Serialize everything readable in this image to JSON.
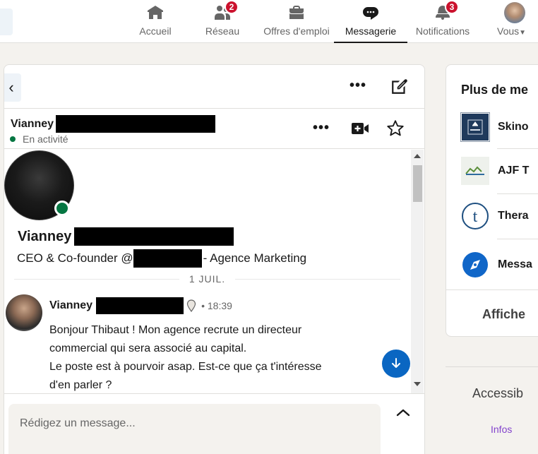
{
  "nav": {
    "items": [
      {
        "label": "Accueil",
        "icon": "home-icon"
      },
      {
        "label": "Réseau",
        "icon": "network-icon",
        "badge": "2"
      },
      {
        "label": "Offres d'emploi",
        "icon": "briefcase-icon"
      },
      {
        "label": "Messagerie",
        "icon": "messaging-icon",
        "active": true
      },
      {
        "label": "Notifications",
        "icon": "bell-icon",
        "badge": "3"
      },
      {
        "label": "Vous",
        "icon": "user-avatar-icon"
      }
    ]
  },
  "conversation": {
    "contact_first_name": "Vianney",
    "status": "En activité",
    "profile": {
      "name": "Vianney",
      "headline_prefix": "CEO & Co-founder @",
      "headline_suffix": "- Agence Marketing"
    },
    "date_separator": "1 JUIL.",
    "messages": [
      {
        "sender": "Vianney",
        "time": "• 18:39",
        "lines": [
          "Bonjour Thibaut ! Mon agence recrute un directeur",
          "commercial qui sera associé au capital.",
          "Le poste est à pourvoir asap. Est-ce que ça t'intéresse",
          "d'en parler ?"
        ]
      }
    ]
  },
  "compose": {
    "placeholder": "Rédigez un message..."
  },
  "sidebar": {
    "title": "Plus de me",
    "items": [
      {
        "name": "Skino"
      },
      {
        "name": "AJF T"
      },
      {
        "name": "Thera"
      },
      {
        "name": "Messa"
      }
    ],
    "more_label": "Affiche"
  },
  "footer": {
    "accessibility": "Accessib",
    "infos": "Infos"
  },
  "colors": {
    "accent": "#0a66c2",
    "badge": "#cb112d",
    "online": "#057642",
    "link_purple": "#8344cc"
  }
}
